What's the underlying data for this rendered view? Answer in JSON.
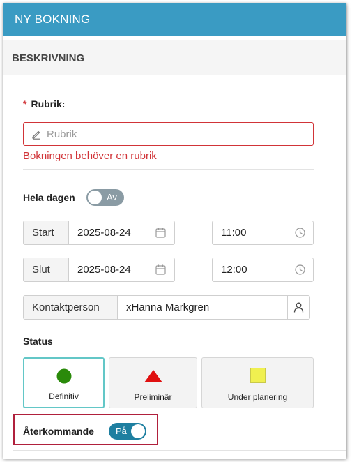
{
  "dialog": {
    "title": "NY BOKNING",
    "section_title": "BESKRIVNING"
  },
  "rubrik": {
    "required_mark": "*",
    "label": "Rubrik",
    "colon": ":",
    "placeholder": "Rubrik",
    "error": "Bokningen behöver en rubrik"
  },
  "all_day": {
    "label": "Hela dagen",
    "toggle_text": "Av",
    "state": "off"
  },
  "start": {
    "label": "Start",
    "date": "2025-08-24",
    "time": "11:00"
  },
  "end": {
    "label": "Slut",
    "date": "2025-08-24",
    "time": "12:00"
  },
  "contact": {
    "label": "Kontaktperson",
    "value": "xHanna Markgren"
  },
  "status": {
    "label": "Status",
    "options": [
      {
        "label": "Definitiv",
        "shape": "circle",
        "color": "#2a8a0a",
        "selected": true
      },
      {
        "label": "Preliminär",
        "shape": "triangle",
        "color": "#e01010",
        "selected": false
      },
      {
        "label": "Under planering",
        "shape": "square",
        "color": "#f0f050",
        "selected": false
      }
    ]
  },
  "recurring": {
    "label": "Återkommande",
    "toggle_text": "På",
    "state": "on"
  },
  "colors": {
    "header": "#3a9bc3",
    "error": "#d13438",
    "toggle_on": "#1e7fa0",
    "toggle_off": "#8a9ba4",
    "selected_border": "#63c7c7",
    "highlight_box": "#b0203c"
  },
  "icons": {
    "rubrik": "pencil-icon",
    "date": "calendar-icon",
    "time": "clock-icon",
    "contact": "person-icon"
  }
}
